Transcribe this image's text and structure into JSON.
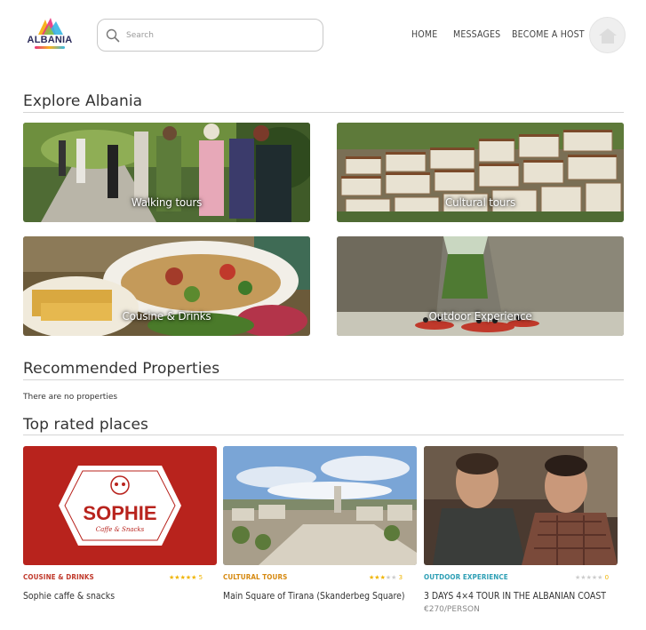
{
  "header": {
    "logo_text": "ALBANIA",
    "search": {
      "placeholder": "Search",
      "value": ""
    },
    "nav": [
      {
        "label": "HOME"
      },
      {
        "label": "MESSAGES"
      },
      {
        "label": "BECOME A HOST"
      }
    ]
  },
  "explore": {
    "title": "Explore Albania",
    "tiles": [
      {
        "label": "Walking tours"
      },
      {
        "label": "Cultural tours"
      },
      {
        "label": "Cousine & Drinks"
      },
      {
        "label": "Outdoor Experience"
      }
    ]
  },
  "recommended": {
    "title": "Recommended Properties",
    "empty_text": "There are no properties"
  },
  "top_rated": {
    "title": "Top rated places",
    "cards": [
      {
        "category": "COUSINE & DRINKS",
        "category_color": "#c0392b",
        "rating": 5,
        "rating_text": "5",
        "title": "Sophie caffe & snacks",
        "image_text": "SOPHIE",
        "image_subtext": "Caffe & Snacks"
      },
      {
        "category": "CULTURAL TOURS",
        "category_color": "#d68910",
        "rating": 3,
        "rating_text": "3",
        "title": "Main Square of Tirana (Skanderbeg Square)"
      },
      {
        "category": "OUTDOOR EXPERIENCE",
        "category_color": "#2e9fb5",
        "rating": 0,
        "rating_text": "0",
        "title": "3 DAYS 4×4 TOUR IN THE ALBANIAN COAST",
        "price": "€270/PERSON"
      }
    ]
  },
  "colors": {
    "star_filled": "#f0b400",
    "star_empty": "#cccccc",
    "sophie_red": "#b8231d"
  }
}
